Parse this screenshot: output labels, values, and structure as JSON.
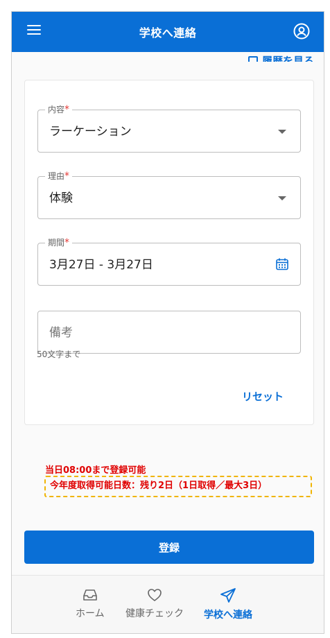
{
  "header": {
    "title": "学校へ連絡",
    "peek_text": "履歴を見る"
  },
  "form": {
    "content": {
      "label": "内容",
      "required_mark": "*",
      "value": "ラーケーション"
    },
    "reason": {
      "label": "理由",
      "required_mark": "*",
      "value": "体験"
    },
    "period": {
      "label": "期間",
      "required_mark": "*",
      "value": "3月27日 - 3月27日"
    },
    "remarks": {
      "placeholder": "備考",
      "hint": "50文字まで"
    },
    "reset_label": "リセット"
  },
  "notices": {
    "deadline": "当日08:00まで登録可能",
    "remaining": "今年度取得可能日数：残り2日（1日取得／最大3日）"
  },
  "submit_label": "登録",
  "nav": {
    "home": "ホーム",
    "health": "健康チェック",
    "contact": "学校へ連絡"
  },
  "colors": {
    "primary": "#0a6fd6",
    "required": "#e53935",
    "notice": "#e00000",
    "highlight_border": "#f0b400"
  }
}
